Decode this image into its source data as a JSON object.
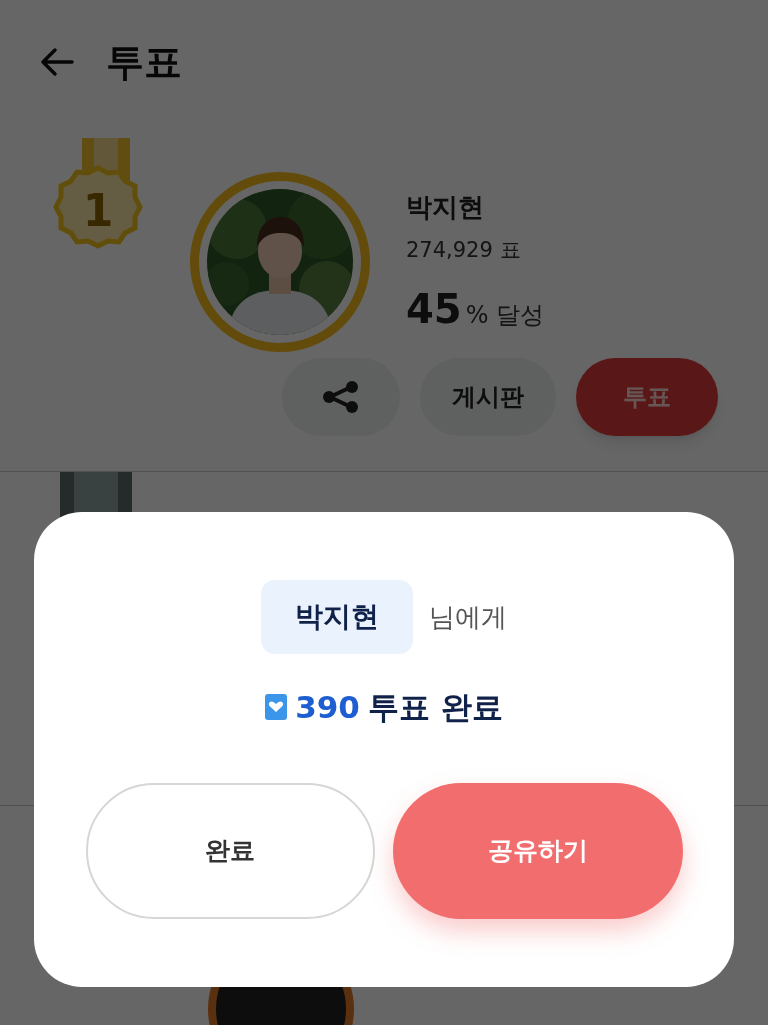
{
  "title": "투표",
  "entry": {
    "rank": "1",
    "name": "박지현",
    "votes": "274,929 표",
    "percent": "45",
    "percent_suffix": "% 달성",
    "board_button": "게시판",
    "vote_button": "투표"
  },
  "dialog": {
    "recipient": "박지현",
    "recipient_suffix": "님에게",
    "amount": "390",
    "result": "투표 완료",
    "buttons": [
      {
        "label": "완료",
        "kind": "outline"
      },
      {
        "label": "공유하기",
        "kind": "primary"
      }
    ]
  }
}
